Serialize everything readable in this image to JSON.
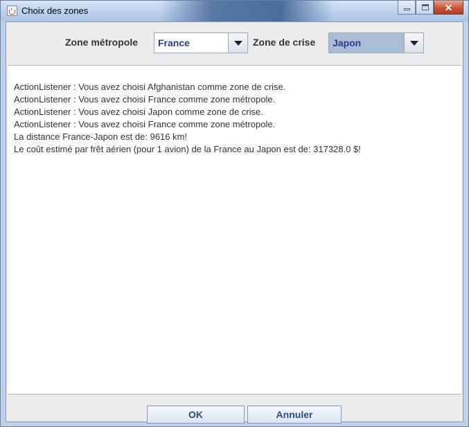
{
  "window": {
    "title": "Choix des zones"
  },
  "zone_metropole": {
    "label": "Zone métropole",
    "selected": "France"
  },
  "zone_crise": {
    "label": "Zone de crise",
    "selected": "Japon"
  },
  "log": [
    "ActionListener : Vous avez choisi Afghanistan comme zone de crise.",
    "ActionListener : Vous avez choisi France comme zone métropole.",
    "ActionListener : Vous avez choisi Japon comme zone de crise.",
    "ActionListener : Vous avez choisi France comme zone métropole.",
    "La distance France-Japon est de: 9616 km!",
    "Le coût estimé par frêt aérien (pour 1 avion) de la France au Japon est de: 317328.0 $!"
  ],
  "buttons": {
    "ok": "OK",
    "cancel": "Annuler"
  },
  "colors": {
    "combo_metropole_bg": "#ffffff",
    "combo_crise_bg": "#a9bdd7",
    "combo_text": "#2b3a8d"
  }
}
